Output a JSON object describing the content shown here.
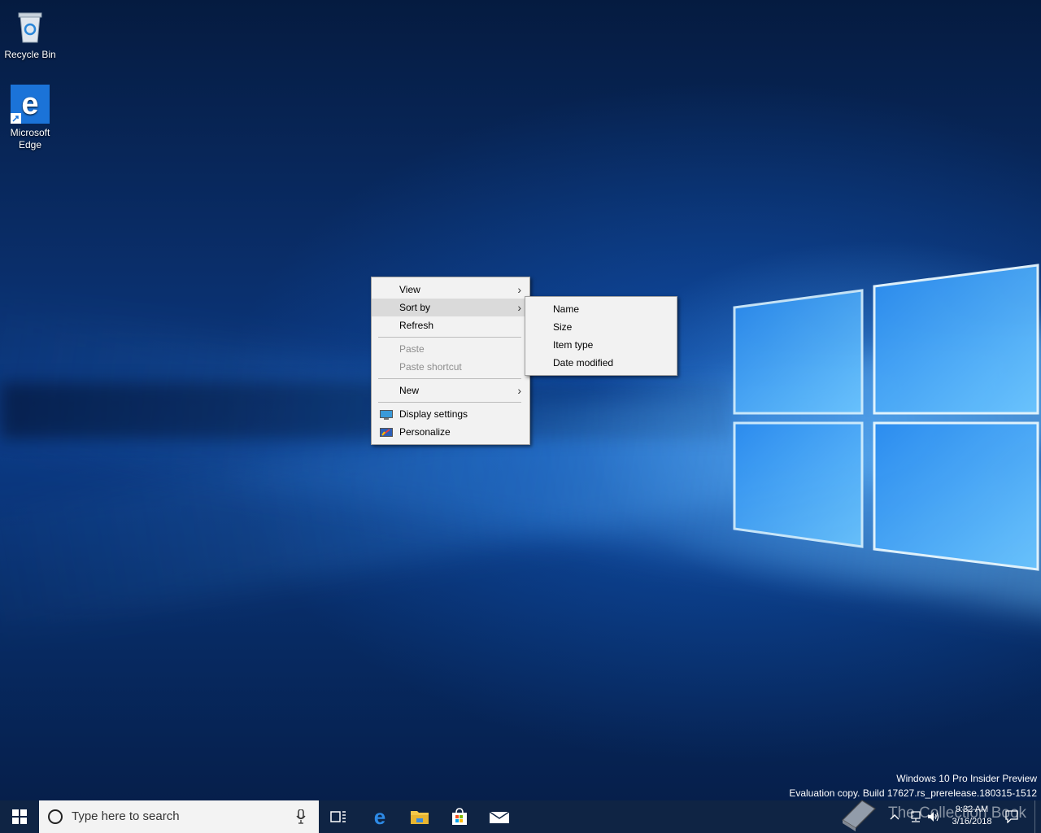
{
  "desktop": {
    "icons": [
      {
        "label": "Recycle Bin",
        "icon": "recycle-bin-icon"
      },
      {
        "label": "Microsoft Edge",
        "icon": "edge-icon"
      }
    ],
    "watermark": {
      "line1": "Windows 10 Pro Insider Preview",
      "line2": "Evaluation copy. Build 17627.rs_prerelease.180315-1512"
    }
  },
  "context_menu": {
    "items": [
      {
        "label": "View",
        "submenu": true
      },
      {
        "label": "Sort by",
        "submenu": true,
        "hover": true
      },
      {
        "label": "Refresh"
      },
      {
        "label": "Paste",
        "disabled": true
      },
      {
        "label": "Paste shortcut",
        "disabled": true
      },
      {
        "label": "New",
        "submenu": true
      },
      {
        "label": "Display settings",
        "icon": "display-icon"
      },
      {
        "label": "Personalize",
        "icon": "personalize-icon"
      }
    ]
  },
  "sort_submenu": {
    "items": [
      {
        "label": "Name"
      },
      {
        "label": "Size"
      },
      {
        "label": "Item type"
      },
      {
        "label": "Date modified"
      }
    ]
  },
  "taskbar": {
    "search_placeholder": "Type here to search",
    "clock_time": "9:32 AM",
    "clock_date": "3/16/2018",
    "overlay_text": "The Collection Book"
  },
  "colors": {
    "taskbar": "#0f2444",
    "menu_bg": "#f2f2f2",
    "menu_hover": "#dadada",
    "accent": "#0078d7"
  }
}
